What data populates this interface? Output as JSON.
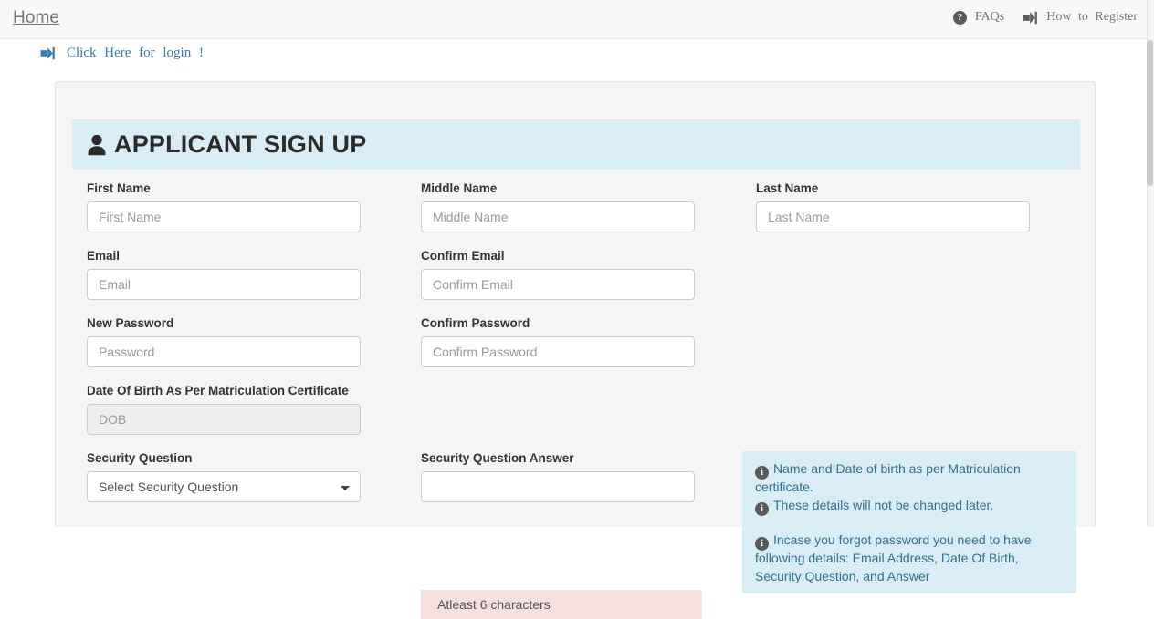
{
  "navbar": {
    "brand": "Home",
    "links": [
      {
        "icon": "question-circle-icon",
        "label": "FAQs"
      },
      {
        "icon": "sign-in-icon",
        "label": "How to Register"
      }
    ]
  },
  "login_strip": {
    "icon": "sign-in-icon",
    "label": "Click Here for login !"
  },
  "page": {
    "icon": "user-icon",
    "title": "APPLICANT SIGN UP"
  },
  "form": {
    "first_name": {
      "label": "First Name",
      "placeholder": "First Name",
      "value": ""
    },
    "middle_name": {
      "label": "Middle Name",
      "placeholder": "Middle Name",
      "value": ""
    },
    "last_name": {
      "label": "Last Name",
      "placeholder": "Last Name",
      "value": ""
    },
    "email": {
      "label": "Email",
      "placeholder": "Email",
      "value": ""
    },
    "confirm_email": {
      "label": "Confirm Email",
      "placeholder": "Confirm Email",
      "value": ""
    },
    "new_password": {
      "label": "New Password",
      "placeholder": "Password",
      "value": ""
    },
    "confirm_password": {
      "label": "Confirm Password",
      "placeholder": "Confirm Password",
      "value": ""
    },
    "dob": {
      "label": "Date Of Birth As Per Matriculation Certificate",
      "placeholder": "DOB",
      "value": ""
    },
    "security_question": {
      "label": "Security Question",
      "selected": "Select Security Question",
      "options": [
        "Select Security Question"
      ]
    },
    "security_answer": {
      "label": "Security Question Answer",
      "placeholder": "",
      "value": ""
    }
  },
  "alerts": {
    "name_dob": {
      "icon": "info-circle-icon",
      "line1": "Name and Date of birth as per Matriculation certificate.",
      "line2": "These details will not be changed later."
    },
    "forgot_password": {
      "icon": "info-circle-icon",
      "line1": "Incase you forgot password you need to have following details: Email Address, Date Of Birth, Security Question, and Answer"
    },
    "password_hint": "Atleast 6 characters"
  },
  "colors": {
    "info_bg": "#d9edf7",
    "info_text": "#31708f",
    "danger_bg": "#f7e0e0",
    "link": "#337ab7",
    "navbar_bg": "#f8f8f8",
    "panel_bg": "#f5f5f5"
  }
}
